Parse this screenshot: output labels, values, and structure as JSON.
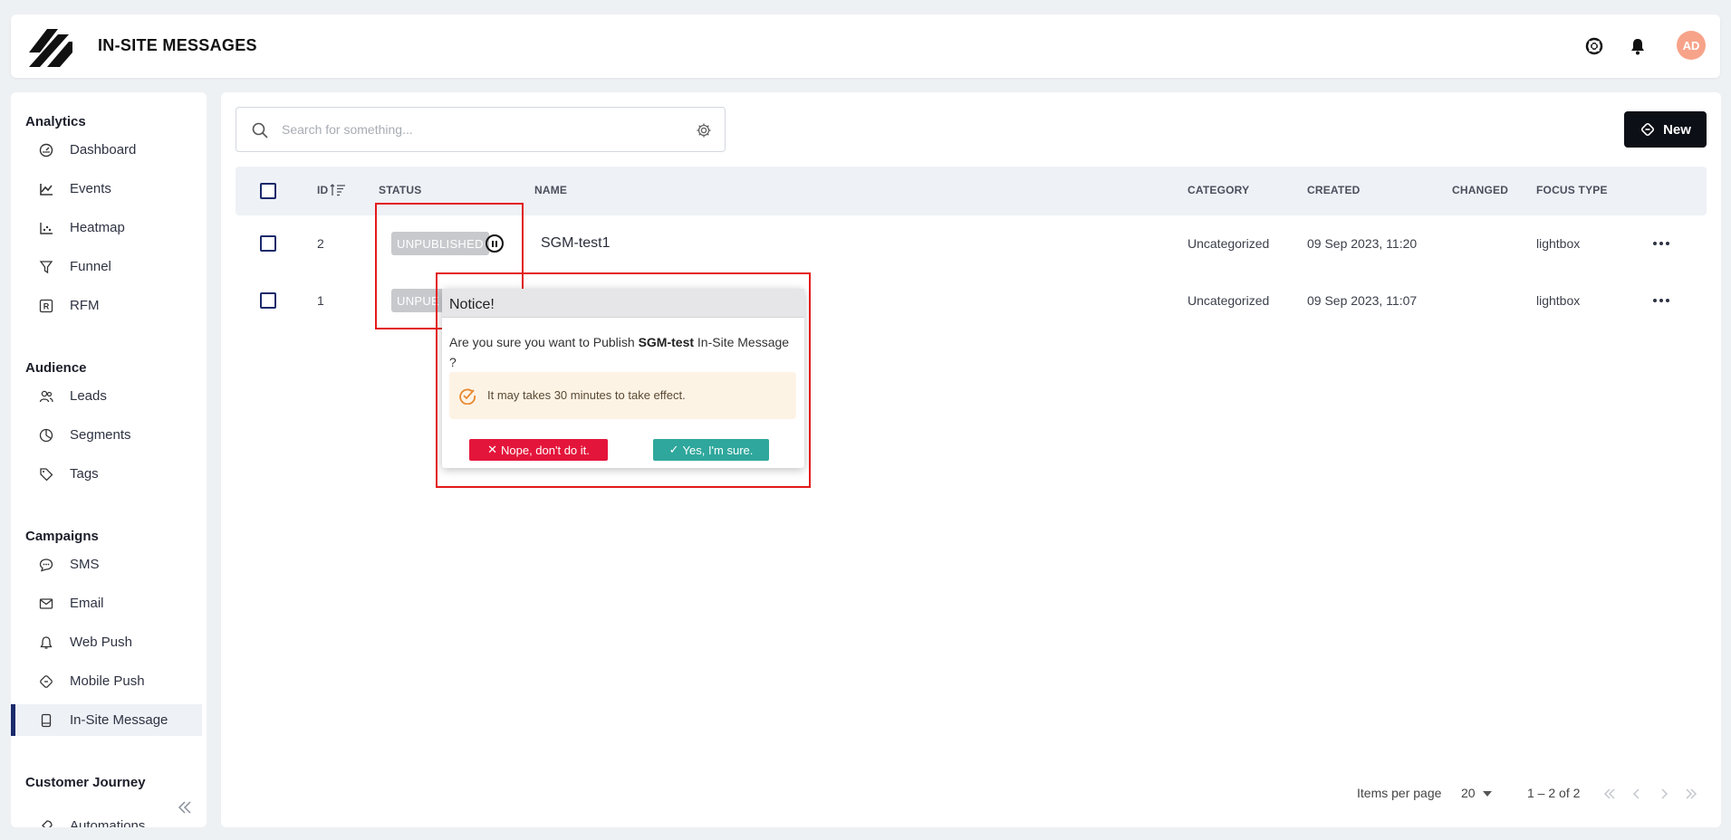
{
  "header": {
    "title": "IN-SITE MESSAGES",
    "avatar_initials": "AD",
    "icons": [
      "support-icon",
      "bell-icon"
    ]
  },
  "sidebar": {
    "sections": [
      {
        "title": "Analytics",
        "items": [
          {
            "label": "Dashboard",
            "icon": "gauge-icon"
          },
          {
            "label": "Events",
            "icon": "line-chart-icon"
          },
          {
            "label": "Heatmap",
            "icon": "scatter-chart-icon"
          },
          {
            "label": "Funnel",
            "icon": "funnel-icon"
          },
          {
            "label": "RFM",
            "icon": "rfm-icon"
          }
        ]
      },
      {
        "title": "Audience",
        "items": [
          {
            "label": "Leads",
            "icon": "users-icon"
          },
          {
            "label": "Segments",
            "icon": "pie-icon"
          },
          {
            "label": "Tags",
            "icon": "tag-icon"
          }
        ]
      },
      {
        "title": "Campaigns",
        "items": [
          {
            "label": "SMS",
            "icon": "chat-icon"
          },
          {
            "label": "Email",
            "icon": "mail-icon"
          },
          {
            "label": "Web Push",
            "icon": "bell-outline-icon"
          },
          {
            "label": "Mobile Push",
            "icon": "mobile-push-icon"
          },
          {
            "label": "In-Site Message",
            "icon": "device-icon",
            "active": true
          }
        ]
      },
      {
        "title": "Customer Journey",
        "items": [
          {
            "label": "Automations",
            "icon": "rocket-icon"
          }
        ]
      }
    ]
  },
  "toolbar": {
    "search_placeholder": "Search for something...",
    "new_label": "New"
  },
  "table": {
    "columns": {
      "id": "ID",
      "status": "STATUS",
      "name": "NAME",
      "category": "CATEGORY",
      "created": "CREATED",
      "changed": "CHANGED",
      "focus_type": "FOCUS TYPE"
    },
    "rows": [
      {
        "id": "2",
        "status": "UNPUBLISHED",
        "name": "SGM-test1",
        "category": "Uncategorized",
        "created": "09 Sep 2023, 11:20",
        "changed": "",
        "focus_type": "lightbox"
      },
      {
        "id": "1",
        "status": "UNPUBLISHED",
        "status_visible": "UNPUE",
        "name": "SGM-test",
        "category": "Uncategorized",
        "created": "09 Sep 2023, 11:07",
        "changed": "",
        "focus_type": "lightbox"
      }
    ]
  },
  "popover": {
    "title": "Notice!",
    "text_before": "Are you sure you want to Publish ",
    "target_name": "SGM-test",
    "text_after": " In-Site Message ?",
    "warning": "It may takes 30 minutes to take effect.",
    "cancel_label": "Nope, don't do it.",
    "confirm_label": "Yes, I'm sure."
  },
  "pagination": {
    "items_per_page_label": "Items per page",
    "page_size": "20",
    "range": "1 – 2 of 2"
  },
  "colors": {
    "highlight": "#e31b1b",
    "cancel": "#e4153b",
    "confirm": "#2fa79c",
    "badge": "#c7c9cd",
    "brand_dark": "#1b2a6b"
  }
}
